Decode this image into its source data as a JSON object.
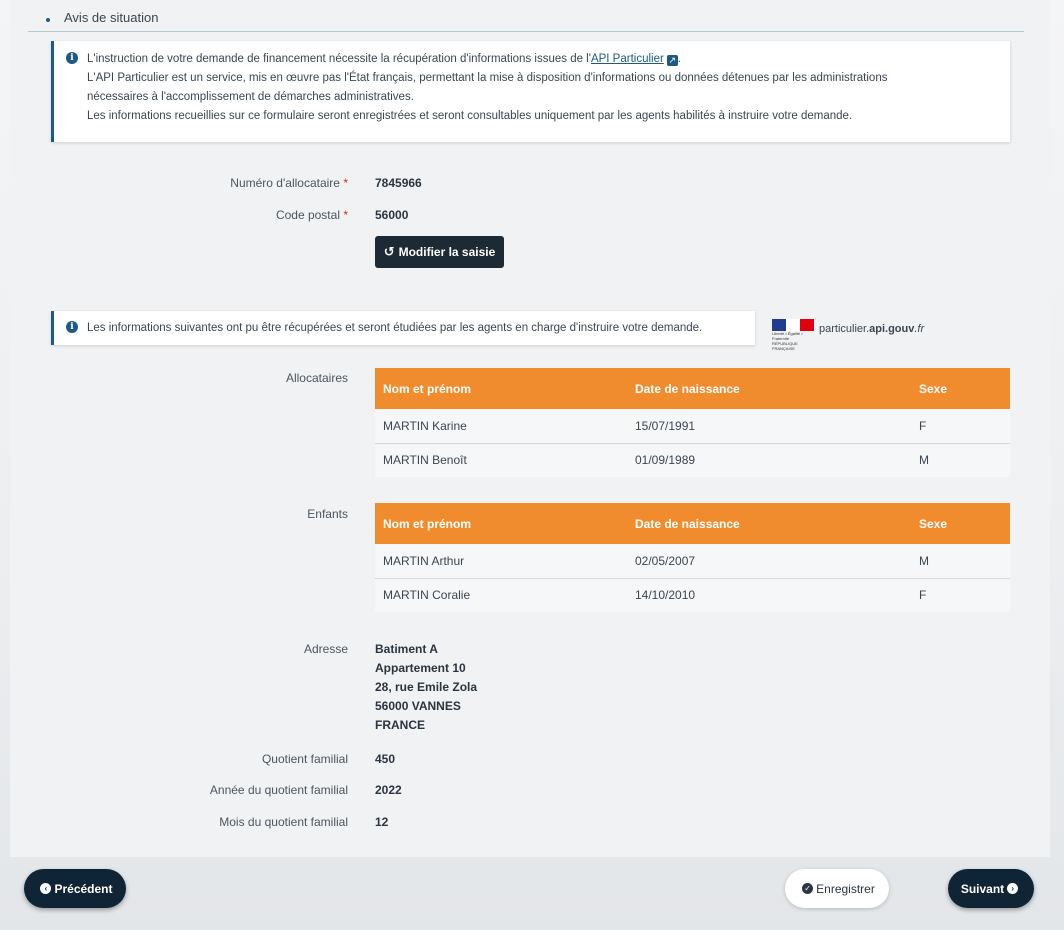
{
  "section": {
    "title": "Avis de situation"
  },
  "info1": {
    "line1_before": "L'instruction de votre demande de financement nécessite la récupération d'informations issues de l'",
    "link": "API Particulier",
    "line1_after": ".",
    "line2": "L'API Particulier est un service, mis en œuvre pas l'État français, permettant la mise à disposition d'informations ou données détenues par les administrations",
    "line3": "nécessaires à l'accomplissement de démarches administratives.",
    "line4": "Les informations recueillies sur ce formulaire seront enregistrées et seront consultables uniquement par les agents habilités à instruire votre demande."
  },
  "form": {
    "allocataire_label": "Numéro d'allocataire",
    "allocataire_value": "7845966",
    "cp_label": "Code postal",
    "cp_value": "56000",
    "required_mark": "*",
    "modify_button": "Modifier la saisie"
  },
  "info2": {
    "text": "Les informations suivantes ont pu être récupérées et seront étudiées par les agents en charge d'instruire votre demande.",
    "api_prefix": "particulier.",
    "api_bold": "api.gouv",
    "api_suffix": ".fr",
    "logo_caption": "Liberté • Égalité • Fraternité RÉPUBLIQUE FRANÇAISE"
  },
  "columns": {
    "name": "Nom et prénom",
    "birth": "Date de naissance",
    "sex": "Sexe"
  },
  "allocataires": {
    "label": "Allocataires",
    "rows": [
      {
        "name": "MARTIN Karine",
        "birth": "15/07/1991",
        "sex": "F"
      },
      {
        "name": "MARTIN Benoît",
        "birth": "01/09/1989",
        "sex": "M"
      }
    ]
  },
  "enfants": {
    "label": "Enfants",
    "rows": [
      {
        "name": "MARTIN Arthur",
        "birth": "02/05/2007",
        "sex": "M"
      },
      {
        "name": "MARTIN Coralie",
        "birth": "14/10/2010",
        "sex": "F"
      }
    ]
  },
  "adresse": {
    "label": "Adresse",
    "lines": [
      "Batiment A",
      "Appartement 10",
      "28, rue Emile Zola",
      "56000 VANNES",
      "FRANCE"
    ]
  },
  "quotient": {
    "qf_label": "Quotient familial",
    "qf_value": "450",
    "year_label": "Année du quotient familial",
    "year_value": "2022",
    "month_label": "Mois du quotient familial",
    "month_value": "12"
  },
  "footer": {
    "prev": "Précédent",
    "save": "Enregistrer",
    "next": "Suivant"
  },
  "colors": {
    "accent": "#1d5a82",
    "table_header": "#f08c2e",
    "dark_button": "#1d2a33"
  }
}
